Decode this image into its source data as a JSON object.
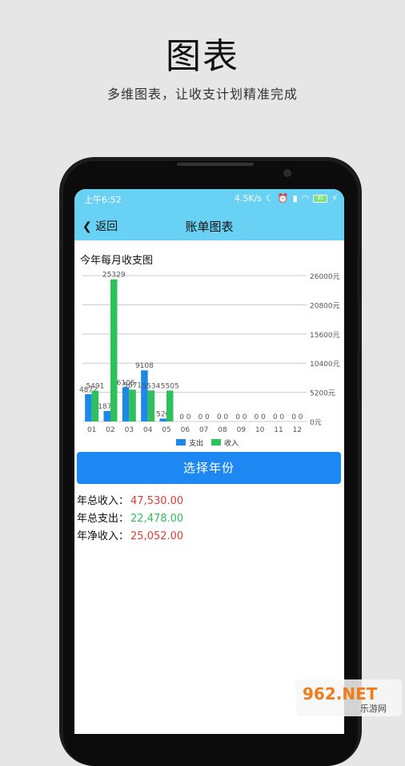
{
  "promo": {
    "title": "图表",
    "subtitle": "多维图表，让收支计划精准完成"
  },
  "status_bar": {
    "time": "上午6:52",
    "speed": "4.5K/s",
    "battery": "85"
  },
  "nav": {
    "back_label": "返回",
    "title": "账单图表"
  },
  "chart_data": {
    "type": "bar",
    "title": "今年每月收支图",
    "categories": [
      "01",
      "02",
      "03",
      "04",
      "05",
      "06",
      "07",
      "08",
      "09",
      "10",
      "11",
      "12"
    ],
    "series": [
      {
        "name": "支出",
        "color": "#1e88e5",
        "values": [
          4872,
          1872,
          6106,
          9108,
          520,
          0,
          0,
          0,
          0,
          0,
          0,
          0
        ]
      },
      {
        "name": "收入",
        "color": "#2ec05a",
        "values": [
          5491,
          25329,
          5671,
          5534,
          5505,
          0,
          0,
          0,
          0,
          0,
          0,
          0
        ]
      }
    ],
    "series_labels": [
      [
        "4872",
        "1872",
        "6106",
        "9108",
        "520",
        "0",
        "0",
        "0",
        "0",
        "0",
        "0",
        "0"
      ],
      [
        "5491",
        "25329",
        "5671",
        "5534",
        "5505",
        "0",
        "0",
        "0",
        "0",
        "0",
        "0",
        "0"
      ]
    ],
    "y_ticks": [
      0,
      5200,
      10400,
      15600,
      20800,
      26000
    ],
    "y_tick_labels": [
      "0元",
      "5200元",
      "10400元",
      "15600元",
      "20800元",
      "26000元"
    ],
    "ylim": [
      0,
      26000
    ],
    "grid": true,
    "legend_position": "bottom-center",
    "y_axis_side": "right"
  },
  "select_year_label": "选择年份",
  "summary": {
    "income_label": "年总收入：",
    "income_value": "47,530.00",
    "income_color": "#e53935",
    "expense_label": "年总支出：",
    "expense_value": "22,478.00",
    "expense_color": "#2ec05a",
    "net_label": "年净收入：",
    "net_value": "25,052.00",
    "net_color": "#e53935"
  },
  "watermark": {
    "brand": "962.NET",
    "sub": "乐游网"
  }
}
